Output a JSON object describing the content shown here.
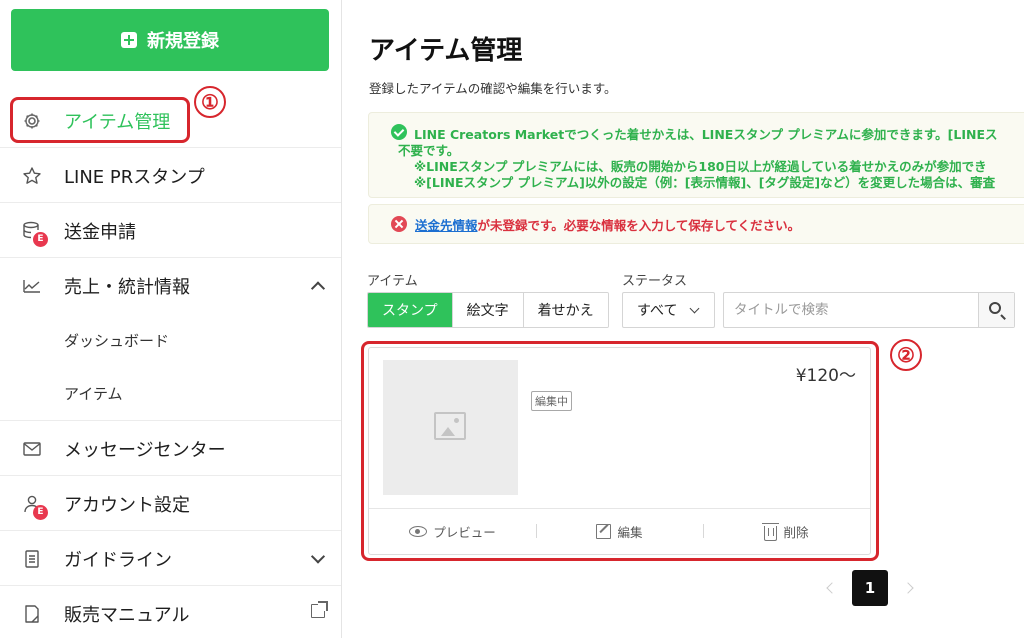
{
  "sidebar": {
    "new_button": "新規登録",
    "items": [
      {
        "label": "アイテム管理",
        "icon": "gear-icon",
        "active": true
      },
      {
        "label": "LINE PRスタンプ",
        "icon": "star-icon"
      },
      {
        "label": "送金申請",
        "icon": "database-icon",
        "badge": "E"
      },
      {
        "label": "売上・統計情報",
        "icon": "chart-icon",
        "expanded": true
      },
      {
        "label": "メッセージセンター",
        "icon": "mail-icon"
      },
      {
        "label": "アカウント設定",
        "icon": "user-icon",
        "badge": "E"
      },
      {
        "label": "ガイドライン",
        "icon": "document-icon"
      },
      {
        "label": "販売マニュアル",
        "icon": "page-icon"
      }
    ],
    "sub_items": [
      "ダッシュボード",
      "アイテム"
    ]
  },
  "annotations": {
    "one": "①",
    "two": "②"
  },
  "main": {
    "title": "アイテム管理",
    "description": "登録したアイテムの確認や編集を行います。",
    "notice_green": {
      "line1": "LINE Creators Marketでつくった着せかえは、LINEスタンプ プレミアムに参加できます。[LINEス",
      "line2": "不要です。",
      "line3": "※LINEスタンプ プレミアムには、販売の開始から180日以上が経過している着せかえのみが参加でき",
      "line4": "※[LINEスタンプ プレミアム]以外の設定（例：[表示情報]、[タグ設定]など）を変更した場合は、審査"
    },
    "notice_red": {
      "link": "送金先情報",
      "text": "が未登録です。必要な情報を入力して保存してください。"
    },
    "filters": {
      "item_label": "アイテム",
      "item_options": [
        "スタンプ",
        "絵文字",
        "着せかえ"
      ],
      "item_selected": "スタンプ",
      "status_label": "ステータス",
      "status_value": "すべて",
      "search_placeholder": "タイトルで検索"
    },
    "card": {
      "badge": "編集中",
      "price": "¥120〜",
      "actions": {
        "preview": "プレビュー",
        "edit": "編集",
        "delete": "削除"
      }
    },
    "pagination": {
      "current": "1"
    }
  },
  "colors": {
    "accent": "#2fc25b",
    "error": "#d9303e",
    "annotation": "#d7262d",
    "link": "#1c6fd1"
  }
}
